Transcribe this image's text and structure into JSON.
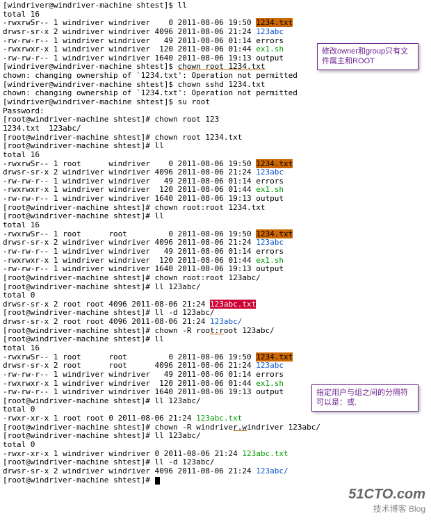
{
  "lines": [
    {
      "pre": "[windriver@windriver-machine shtest]$ ll"
    },
    {
      "pre": "total 16"
    },
    {
      "pre": "-rwxrwSr-- 1 windriver windriver    0 2011-08-06 19:50 ",
      "f": "1234.txt",
      "c": "hl1"
    },
    {
      "pre": "drwsr-sr-x 2 windriver windriver 4096 2011-08-06 21:24 ",
      "f": "123abc",
      "c": "bl"
    },
    {
      "pre": "-rw-rw-r-- 1 windriver windriver   49 2011-08-06 01:14 errors"
    },
    {
      "pre": "-rwxrwxr-x 1 windriver windriver  120 2011-08-06 01:44 ",
      "f": "ex1.sh",
      "c": "gn"
    },
    {
      "pre": "-rw-rw-r-- 1 windriver windriver 1640 2011-08-06 19:13 output"
    },
    {
      "pre": "[windriver@windriver-machine shtest]$ ",
      "ul": "chown root 1234.txt"
    },
    {
      "pre": "chown: changing ownership of `1234.txt': Operation not permitted"
    },
    {
      "pre": "[windriver@windriver-machine shtest]$ chown sshd 1234.txt"
    },
    {
      "pre": "chown: changing ownership of `1234.txt': Operation not permitted"
    },
    {
      "pre": "[windriver@windriver-machine shtest]$ su root"
    },
    {
      "pre": "Password:"
    },
    {
      "pre": "[root@windriver-machine shtest]# chown root 123"
    },
    {
      "pre": "1234.txt  123abc/"
    },
    {
      "pre": "[root@windriver-machine shtest]# chown root 1234.txt"
    },
    {
      "pre": "[root@windriver-machine shtest]# ll"
    },
    {
      "pre": "total 16"
    },
    {
      "pre": "-rwxrwSr-- 1 root      windriver    0 2011-08-06 19:50 ",
      "f": "1234.txt",
      "c": "hl1"
    },
    {
      "pre": "drwsr-sr-x 2 windriver windriver 4096 2011-08-06 21:24 ",
      "f": "123abc",
      "c": "bl"
    },
    {
      "pre": "-rw-rw-r-- 1 windriver windriver   49 2011-08-06 01:14 errors"
    },
    {
      "pre": "-rwxrwxr-x 1 windriver windriver  120 2011-08-06 01:44 ",
      "f": "ex1.sh",
      "c": "gn"
    },
    {
      "pre": "-rw-rw-r-- 1 windriver windriver 1640 2011-08-06 19:13 output"
    },
    {
      "pre": "[root@windriver-machine shtest]# chown root:root 1234.txt"
    },
    {
      "pre": "[root@windriver-machine shtest]# ll"
    },
    {
      "pre": "total 16"
    },
    {
      "pre": "-rwxrwSr-- 1 root      root         0 2011-08-06 19:50 ",
      "f": "1234.txt",
      "c": "hl1"
    },
    {
      "pre": "drwsr-sr-x 2 windriver windriver 4096 2011-08-06 21:24 ",
      "f": "123abc",
      "c": "bl"
    },
    {
      "pre": "-rw-rw-r-- 1 windriver windriver   49 2011-08-06 01:14 errors"
    },
    {
      "pre": "-rwxrwxr-x 1 windriver windriver  120 2011-08-06 01:44 ",
      "f": "ex1.sh",
      "c": "gn"
    },
    {
      "pre": "-rw-rw-r-- 1 windriver windriver 1640 2011-08-06 19:13 output"
    },
    {
      "pre": "[root@windriver-machine shtest]# chown root:root 123abc/"
    },
    {
      "pre": "[root@windriver-machine shtest]# ll 123abc/"
    },
    {
      "pre": "total 0"
    },
    {
      "pre": "drwsr-sr-x 2 root root 4096 2011-08-06 21:24 ",
      "f": "123abc.txt",
      "c": "hl2"
    },
    {
      "pre": "[root@windriver-machine shtest]# ll -d 123abc/"
    },
    {
      "pre": "drwsr-sr-x 2 root root 4096 2011-08-06 21:24 ",
      "f": "123abc/",
      "c": "bl"
    },
    {
      "pre": "[root@windriver-machine shtest]# chown -R roo",
      "ul": "t:r",
      "post": "oot 123abc/"
    },
    {
      "pre": "[root@windriver-machine shtest]# ll"
    },
    {
      "pre": "total 16"
    },
    {
      "pre": "-rwxrwSr-- 1 root      root         0 2011-08-06 19:50 ",
      "f": "1234.txt",
      "c": "hl1"
    },
    {
      "pre": "drwsr-sr-x 2 root      root      4096 2011-08-06 21:24 ",
      "f": "123abc",
      "c": "bl"
    },
    {
      "pre": "-rw-rw-r-- 1 windriver windriver   49 2011-08-06 01:14 errors"
    },
    {
      "pre": "-rwxrwxr-x 1 windriver windriver  120 2011-08-06 01:44 ",
      "f": "ex1.sh",
      "c": "gn"
    },
    {
      "pre": "-rw-rw-r-- 1 windriver windriver 1640 2011-08-06 19:13 output"
    },
    {
      "pre": "[root@windriver-machine shtest]# ll 123abc/"
    },
    {
      "pre": "total 0"
    },
    {
      "pre": "-rwxr-xr-x 1 root root 0 2011-08-06 21:24 ",
      "f": "123abc.txt",
      "c": "gn"
    },
    {
      "pre": "[root@windriver-machine shtest]# chown -R windrive",
      "ul": "r.w",
      "post": "indriver 123abc/"
    },
    {
      "pre": "[root@windriver-machine shtest]# ll 123abc/"
    },
    {
      "pre": "total 0"
    },
    {
      "pre": "-rwxr-xr-x 1 windriver windriver 0 2011-08-06 21:24 ",
      "f": "123abc.txt",
      "c": "gn"
    },
    {
      "pre": "[root@windriver-machine shtest]# ll -d 123abc/"
    },
    {
      "pre": "drwsr-sr-x 2 windriver windriver 4096 2011-08-06 21:24 ",
      "f": "123abc/",
      "c": "bl"
    },
    {
      "pre": "[root@windriver-machine shtest]# ",
      "cur": true
    }
  ],
  "note1": "修改owner和group只有文件属主和ROOT",
  "note2": "指定用户与组之间的分隔符可以是：或.",
  "brand_big": "51CTO.com",
  "brand_sub": "技术博客   Blog"
}
